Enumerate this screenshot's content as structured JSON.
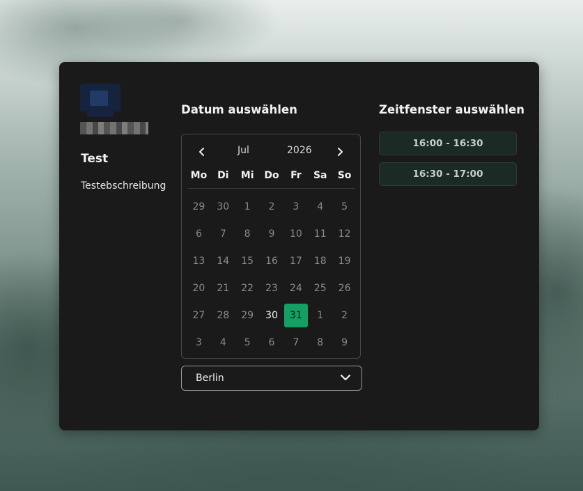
{
  "event": {
    "title": "Test",
    "description": "Testebschreibung"
  },
  "calendar": {
    "heading": "Datum auswählen",
    "month": "Jul",
    "year": "2026",
    "prev_icon": "chevron-left-icon",
    "next_icon": "chevron-right-icon",
    "weekdays": [
      "Mo",
      "Di",
      "Mi",
      "Do",
      "Fr",
      "Sa",
      "So"
    ],
    "days": [
      {
        "label": "29",
        "available": false,
        "selected": false
      },
      {
        "label": "30",
        "available": false,
        "selected": false
      },
      {
        "label": "1",
        "available": false,
        "selected": false
      },
      {
        "label": "2",
        "available": false,
        "selected": false
      },
      {
        "label": "3",
        "available": false,
        "selected": false
      },
      {
        "label": "4",
        "available": false,
        "selected": false
      },
      {
        "label": "5",
        "available": false,
        "selected": false
      },
      {
        "label": "6",
        "available": false,
        "selected": false
      },
      {
        "label": "7",
        "available": false,
        "selected": false
      },
      {
        "label": "8",
        "available": false,
        "selected": false
      },
      {
        "label": "9",
        "available": false,
        "selected": false
      },
      {
        "label": "10",
        "available": false,
        "selected": false
      },
      {
        "label": "11",
        "available": false,
        "selected": false
      },
      {
        "label": "12",
        "available": false,
        "selected": false
      },
      {
        "label": "13",
        "available": false,
        "selected": false
      },
      {
        "label": "14",
        "available": false,
        "selected": false
      },
      {
        "label": "15",
        "available": false,
        "selected": false
      },
      {
        "label": "16",
        "available": false,
        "selected": false
      },
      {
        "label": "17",
        "available": false,
        "selected": false
      },
      {
        "label": "18",
        "available": false,
        "selected": false
      },
      {
        "label": "19",
        "available": false,
        "selected": false
      },
      {
        "label": "20",
        "available": false,
        "selected": false
      },
      {
        "label": "21",
        "available": false,
        "selected": false
      },
      {
        "label": "22",
        "available": false,
        "selected": false
      },
      {
        "label": "23",
        "available": false,
        "selected": false
      },
      {
        "label": "24",
        "available": false,
        "selected": false
      },
      {
        "label": "25",
        "available": false,
        "selected": false
      },
      {
        "label": "26",
        "available": false,
        "selected": false
      },
      {
        "label": "27",
        "available": false,
        "selected": false
      },
      {
        "label": "28",
        "available": false,
        "selected": false
      },
      {
        "label": "29",
        "available": false,
        "selected": false
      },
      {
        "label": "30",
        "available": true,
        "selected": false
      },
      {
        "label": "31",
        "available": true,
        "selected": true
      },
      {
        "label": "1",
        "available": false,
        "selected": false
      },
      {
        "label": "2",
        "available": false,
        "selected": false
      },
      {
        "label": "3",
        "available": false,
        "selected": false
      },
      {
        "label": "4",
        "available": false,
        "selected": false
      },
      {
        "label": "5",
        "available": false,
        "selected": false
      },
      {
        "label": "6",
        "available": false,
        "selected": false
      },
      {
        "label": "7",
        "available": false,
        "selected": false
      },
      {
        "label": "8",
        "available": false,
        "selected": false
      },
      {
        "label": "9",
        "available": false,
        "selected": false
      }
    ]
  },
  "timezone": {
    "value": "Berlin",
    "icon": "chevron-down-icon"
  },
  "timeslots": {
    "heading": "Zeitfenster auswählen",
    "items": [
      "16:00 - 16:30",
      "16:30 - 17:00"
    ]
  },
  "colors": {
    "selected_day": "#14a062",
    "card": "#1a1a1a",
    "slot_bg": "#1b2a24"
  }
}
